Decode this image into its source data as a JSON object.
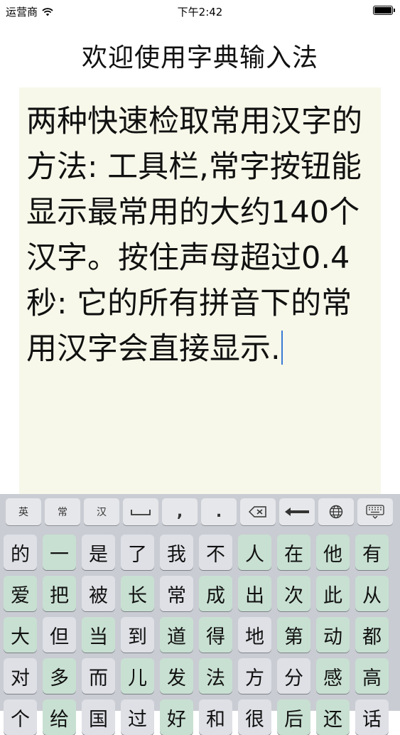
{
  "status_bar": {
    "carrier": "运营商",
    "time": "下午2:42"
  },
  "title": "欢迎使用字典输入法",
  "editor": {
    "text": "两种快速检取常用汉字的方法: 工具栏,常字按钮能显示最常用的大约140个汉字。按住声母超过0.4秒: 它的所有拼音下的常用汉字会直接显示."
  },
  "toolbar": {
    "english": "英",
    "common": "常",
    "chinese": "汉",
    "comma": ",",
    "period": "."
  },
  "char_rows": [
    [
      "的",
      "一",
      "是",
      "了",
      "我",
      "不",
      "人",
      "在",
      "他",
      "有"
    ],
    [
      "爱",
      "把",
      "被",
      "长",
      "常",
      "成",
      "出",
      "次",
      "此",
      "从"
    ],
    [
      "大",
      "但",
      "当",
      "到",
      "道",
      "得",
      "地",
      "第",
      "动",
      "都"
    ],
    [
      "对",
      "多",
      "而",
      "儿",
      "发",
      "法",
      "方",
      "分",
      "感",
      "高"
    ],
    [
      "个",
      "给",
      "国",
      "过",
      "好",
      "和",
      "很",
      "后",
      "还",
      "话"
    ]
  ],
  "colors": {
    "green_key": "#c8e0d2",
    "grey_key": "#dfe0e6",
    "editor_bg": "#f7f8ea",
    "keyboard_bg": "#c9ccd3"
  }
}
